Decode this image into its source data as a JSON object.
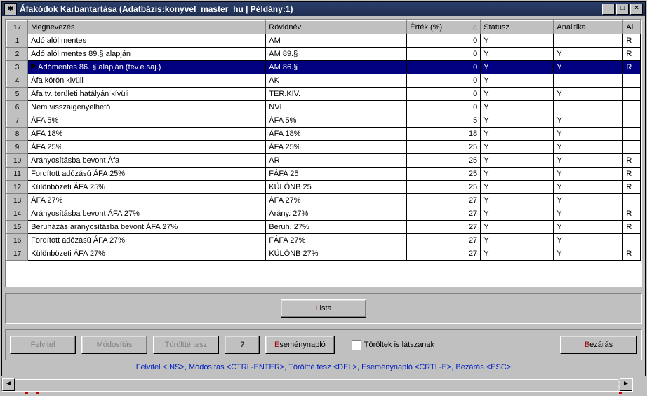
{
  "window": {
    "title": "Áfakódok Karbantartása   (Adatbázis:konyvel_master_hu | Példány:1)",
    "corner": "17",
    "min_label": "_",
    "max_label": "□",
    "close_label": "×"
  },
  "columns": {
    "name": "Megnevezés",
    "short": "Rövidnév",
    "value": "Érték (%)",
    "status": "Statusz",
    "analytic": "Analitika",
    "cut": "Al"
  },
  "rows": [
    {
      "n": "1",
      "name": "Adó alól mentes",
      "short": "AM",
      "val": "0",
      "stat": "Y",
      "an": "",
      "cut": "R"
    },
    {
      "n": "2",
      "name": "Adó alól mentes 89.§ alapján",
      "short": "AM 89.§",
      "val": "0",
      "stat": "Y",
      "an": "Y",
      "cut": "R"
    },
    {
      "n": "3",
      "name": "Adómentes 86. § alapján (tev.e.saj.)",
      "short": "AM 86.§",
      "val": "0",
      "stat": "Y",
      "an": "Y",
      "cut": "R",
      "sel": true,
      "ind": "▶"
    },
    {
      "n": "4",
      "name": "Áfa körön kivüli",
      "short": "AK",
      "val": "0",
      "stat": "Y",
      "an": "",
      "cut": ""
    },
    {
      "n": "5",
      "name": "Áfa tv. területi hatályán kívüli",
      "short": "TER.KIV.",
      "val": "0",
      "stat": "Y",
      "an": "Y",
      "cut": ""
    },
    {
      "n": "6",
      "name": "Nem visszaigényelhető",
      "short": "NVI",
      "val": "0",
      "stat": "Y",
      "an": "",
      "cut": ""
    },
    {
      "n": "7",
      "name": "ÁFA 5%",
      "short": "ÁFA 5%",
      "val": "5",
      "stat": "Y",
      "an": "Y",
      "cut": ""
    },
    {
      "n": "8",
      "name": "ÁFA 18%",
      "short": "ÁFA 18%",
      "val": "18",
      "stat": "Y",
      "an": "Y",
      "cut": ""
    },
    {
      "n": "9",
      "name": "ÁFA 25%",
      "short": "ÁFA 25%",
      "val": "25",
      "stat": "Y",
      "an": "Y",
      "cut": ""
    },
    {
      "n": "10",
      "name": "Arányosításba bevont Áfa",
      "short": "AR",
      "val": "25",
      "stat": "Y",
      "an": "Y",
      "cut": "R"
    },
    {
      "n": "11",
      "name": "Fordított adózású ÁFA 25%",
      "short": "FÁFA 25",
      "val": "25",
      "stat": "Y",
      "an": "Y",
      "cut": "R"
    },
    {
      "n": "12",
      "name": "Különbözeti ÁFA 25%",
      "short": "KÜLÖNB 25",
      "val": "25",
      "stat": "Y",
      "an": "Y",
      "cut": "R"
    },
    {
      "n": "13",
      "name": "ÁFA 27%",
      "short": "ÁFA 27%",
      "val": "27",
      "stat": "Y",
      "an": "Y",
      "cut": ""
    },
    {
      "n": "14",
      "name": "Arányosításba bevont ÁFA 27%",
      "short": "Arány. 27%",
      "val": "27",
      "stat": "Y",
      "an": "Y",
      "cut": "R"
    },
    {
      "n": "15",
      "name": "Beruházás arányosításba bevont ÁFA 27%",
      "short": "Beruh. 27%",
      "val": "27",
      "stat": "Y",
      "an": "Y",
      "cut": "R"
    },
    {
      "n": "16",
      "name": "Fordított adózású ÁFA 27%",
      "short": "FÁFA 27%",
      "val": "27",
      "stat": "Y",
      "an": "Y",
      "cut": ""
    },
    {
      "n": "17",
      "name": "Különbözeti ÁFA 27%",
      "short": "KÜLÖNB 27%",
      "val": "27",
      "stat": "Y",
      "an": "Y",
      "cut": "R"
    }
  ],
  "buttons": {
    "lista": {
      "pre": "",
      "hot": "L",
      "post": "ista"
    },
    "felvitel": {
      "pre": "",
      "hot": "F",
      "post": "elvitel"
    },
    "modositas": {
      "pre": "",
      "hot": "M",
      "post": "ódosítás"
    },
    "torolte": {
      "pre": "",
      "hot": "T",
      "post": "öröltté tesz"
    },
    "help": {
      "pre": "",
      "hot": "?",
      "post": ""
    },
    "esemeny": {
      "pre": "",
      "hot": "E",
      "post": "seménynapló"
    },
    "bezaras": {
      "pre": "",
      "hot": "B",
      "post": "ezárás"
    }
  },
  "checkbox": {
    "label": "Töröltek is látszanak"
  },
  "helpline": "Felvitel <INS>,   Módosítás <CTRL-ENTER>,   Töröltté tesz <DEL>,   Eseménynapló <CRTL-E>,   Bezárás <ESC>"
}
